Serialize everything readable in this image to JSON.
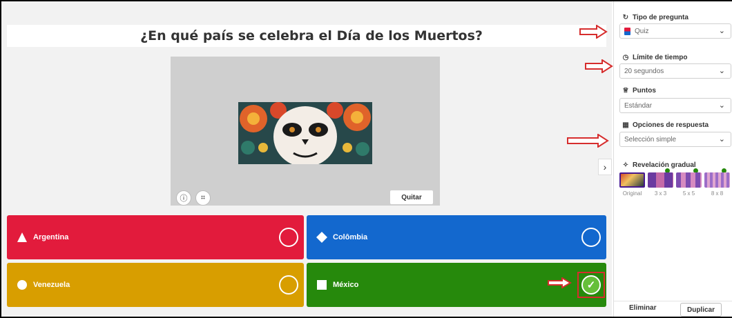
{
  "question": {
    "text": "¿En qué país se celebra el Día de los Muertos?"
  },
  "media": {
    "remove_label": "Quitar"
  },
  "answers": [
    {
      "label": "Argentina",
      "color": "#e21b3c",
      "shape": "triangle",
      "correct": false
    },
    {
      "label": "Colômbia",
      "color": "#1368ce",
      "shape": "diamond",
      "correct": false
    },
    {
      "label": "Venezuela",
      "color": "#d89e00",
      "shape": "circle",
      "correct": false
    },
    {
      "label": "México",
      "color": "#26890c",
      "shape": "square",
      "correct": true
    }
  ],
  "sidebar": {
    "question_type": {
      "label": "Tipo de pregunta",
      "value": "Quiz"
    },
    "time_limit": {
      "label": "Límite de tiempo",
      "value": "20 segundos"
    },
    "points": {
      "label": "Puntos",
      "value": "Estándar"
    },
    "answer_options": {
      "label": "Opciones de respuesta",
      "value": "Selección simple"
    },
    "reveal": {
      "label": "Revelación gradual",
      "options": [
        "Original",
        "3 x 3",
        "5 x 5",
        "8 x 8"
      ]
    },
    "delete_label": "Eliminar",
    "duplicate_label": "Duplicar"
  },
  "colors": {
    "accent_purple": "#46178f",
    "annotation_red": "#d62d2d"
  }
}
